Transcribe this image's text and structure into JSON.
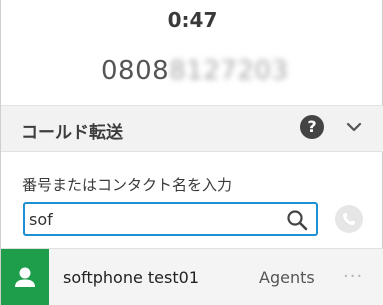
{
  "call": {
    "timer": "0:47",
    "phone_visible": "0808",
    "phone_redacted": "8127203"
  },
  "transfer": {
    "title": "コールド転送",
    "help_symbol": "?",
    "input_label": "番号またはコンタクト名を入力",
    "search_value": "sof"
  },
  "results": [
    {
      "name": "softphone test01",
      "group": "Agents",
      "more": "···"
    }
  ],
  "colors": {
    "accent_blue": "#1e8fd0",
    "avatar_green": "#1e9e4a",
    "header_bg": "#f2f2f2"
  },
  "icons": [
    "help-icon",
    "chevron-down-icon",
    "search-icon",
    "phone-icon",
    "user-icon",
    "more-icon"
  ]
}
